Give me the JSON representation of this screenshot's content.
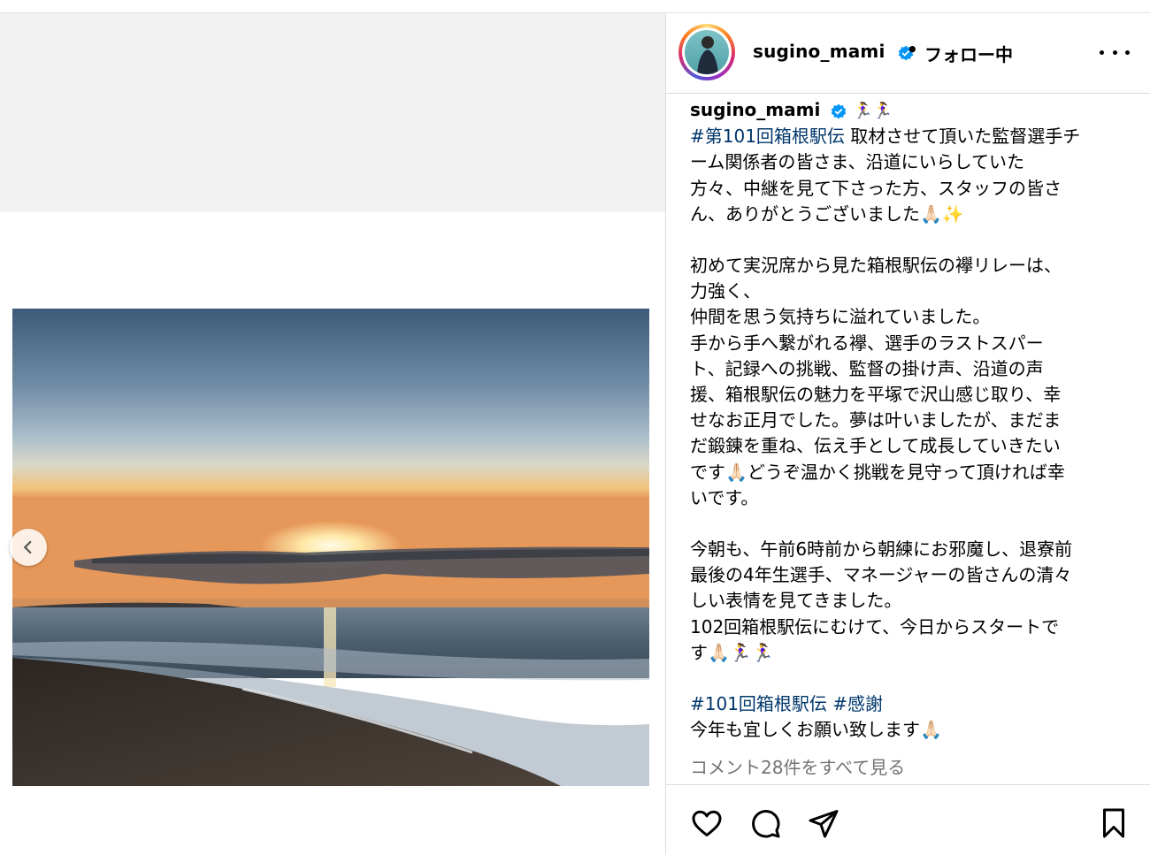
{
  "post": {
    "username": "sugino_mami",
    "separator": "•",
    "follow_label": "フォロー中",
    "caption": {
      "username": "sugino_mami",
      "runner_emoji": "🏃‍♀️🏃‍♀️",
      "hashtag_1": "#第101回箱根駅伝",
      "p1_lines": [
        " 取材させて頂いた監督選手チ",
        "ーム関係者の皆さま、沿道にいらしていた",
        "方々、中継を見て下さった方、スタッフの皆さ",
        "ん、ありがとうございました🙏🏻✨"
      ],
      "p2_lines": [
        "初めて実況席から見た箱根駅伝の襷リレーは、",
        "力強く、",
        "仲間を思う気持ちに溢れていました。",
        "手から手へ繋がれる襷、選手のラストスパー",
        "ト、記録への挑戦、監督の掛け声、沿道の声",
        "援、箱根駅伝の魅力を平塚で沢山感じ取り、幸",
        "せなお正月でした。夢は叶いましたが、まだま",
        "だ鍛錬を重ね、伝え手として成長していきたい",
        "です🙏🏻どうぞ温かく挑戦を見守って頂ければ幸",
        "いです。"
      ],
      "p3_lines": [
        "今朝も、午前6時前から朝練にお邪魔し、退寮前",
        "最後の4年生選手、マネージャーの皆さんの清々",
        "しい表情を見てきました。",
        "102回箱根駅伝にむけて、今日からスタートで",
        "す🙏🏻🏃‍♀️🏃‍♀️"
      ],
      "hashtag_2": "#101回箱根駅伝",
      "hashtag_3": "#感謝",
      "closing": "今年も宜しくお願い致します🙏🏻"
    },
    "comments_link": "コメント28件をすべて見る"
  },
  "icons": {
    "verified": "verified-badge-icon",
    "prev": "chevron-left-icon",
    "more": "more-options-icon",
    "like": "heart-icon",
    "comment": "comment-icon",
    "share": "send-icon",
    "save": "bookmark-icon"
  },
  "colors": {
    "hashtag": "#00376b",
    "verified": "#0095f6",
    "muted": "#737373"
  }
}
